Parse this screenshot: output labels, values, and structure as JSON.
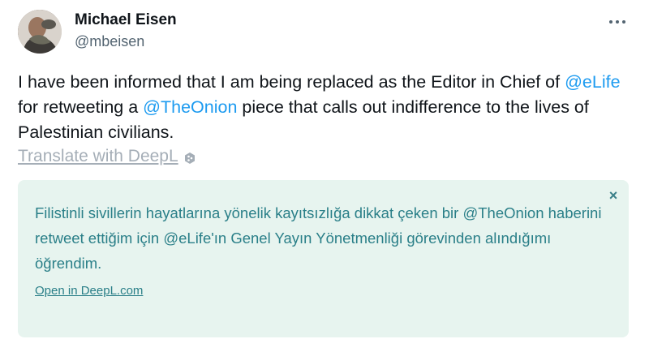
{
  "author": {
    "name": "Michael Eisen",
    "handle": "@mbeisen"
  },
  "tweet": {
    "part1": "I have been informed that I am being replaced as the Editor in Chief of ",
    "mention1": "@eLife",
    "part2": " for retweeting a ",
    "mention2": "@TheOnion",
    "part3": " piece that calls out indifference to the lives of Palestinian civilians."
  },
  "translate": {
    "label": "Translate with DeepL"
  },
  "translation_panel": {
    "close_glyph": "×",
    "text": "Filistinli sivillerin hayatlarına yönelik kayıtsızlığa dikkat çeken bir @TheOnion haberini retweet ettiğim için @eLife'ın Genel Yayın Yönetmenliği görevinden alındığımı öğrendim.",
    "open_link": "Open in DeepL.com"
  },
  "colors": {
    "mention": "#1d9bf0",
    "panel_bg": "#e7f4ef",
    "panel_text": "#2a7f88"
  },
  "icons": [
    "more-options-icon",
    "deepl-icon",
    "close-icon",
    "avatar"
  ]
}
